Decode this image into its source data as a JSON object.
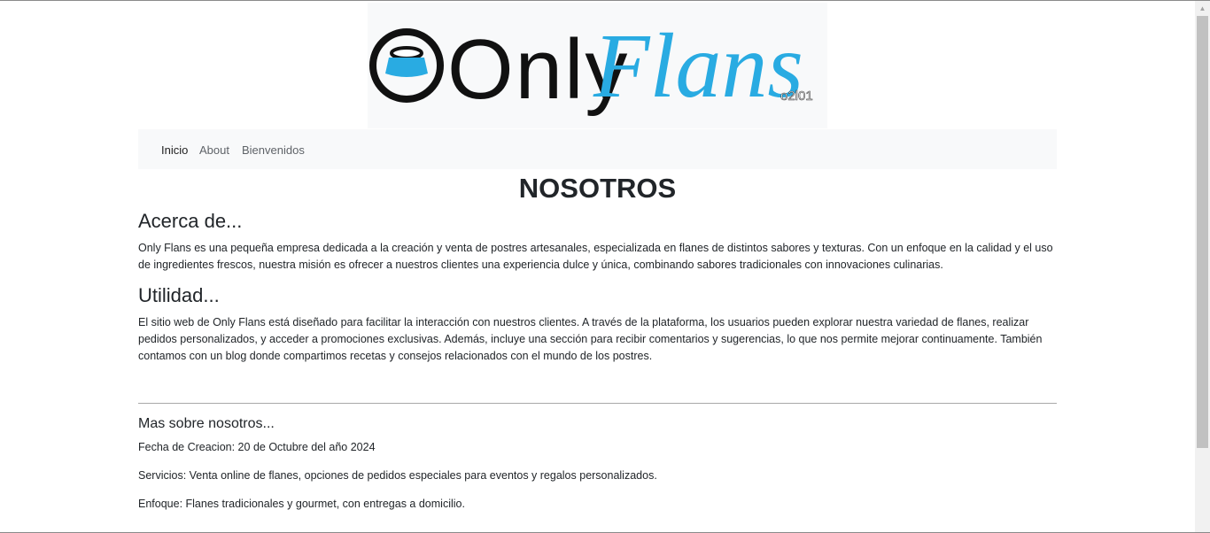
{
  "logo": {
    "word_only": "Only",
    "word_flans": "Flans",
    "tag": "o2l01"
  },
  "nav": {
    "items": [
      "Inicio",
      "About",
      "Bienvenidos"
    ]
  },
  "page_title": "NOSOTROS",
  "about": {
    "heading": "Acerca de...",
    "lines": [
      "Only Flans es una pequeña empresa dedicada a la creación y venta de postres artesanales, especializada en flanes de distintos sabores y texturas. Con un enfoque en la calidad y el uso",
      "de ingredientes frescos, nuestra misión es ofrecer a nuestros clientes una experiencia dulce y única, combinando sabores tradicionales con innovaciones culinarias."
    ]
  },
  "utility": {
    "heading": "Utilidad...",
    "lines": [
      "El sitio web de Only Flans está diseñado para facilitar la interacción con nuestros clientes. A través de la plataforma, los usuarios pueden explorar nuestra variedad de flanes, realizar",
      "pedidos personalizados, y acceder a promociones exclusivas. Además, incluye una sección para recibir comentarios y sugerencias, lo que nos permite mejorar continuamente. También",
      "contamos con un blog donde compartimos recetas y consejos relacionados con el mundo de los postres."
    ]
  },
  "more": {
    "heading": "Mas sobre nosotros...",
    "facts": [
      "Fecha de Creacion: 20 de Octubre del año 2024",
      "Servicios: Venta online de flanes, opciones de pedidos especiales para eventos y regalos personalizados.",
      "Enfoque: Flanes tradicionales y gourmet, con entregas a domicilio."
    ]
  },
  "colors": {
    "brand_blue": "#29abe2",
    "logo_black": "#111111",
    "nav_bg": "#f8f9fa"
  },
  "icons": {
    "logo_mark": "flan-icon",
    "scroll_up": "triangle-up-icon"
  }
}
